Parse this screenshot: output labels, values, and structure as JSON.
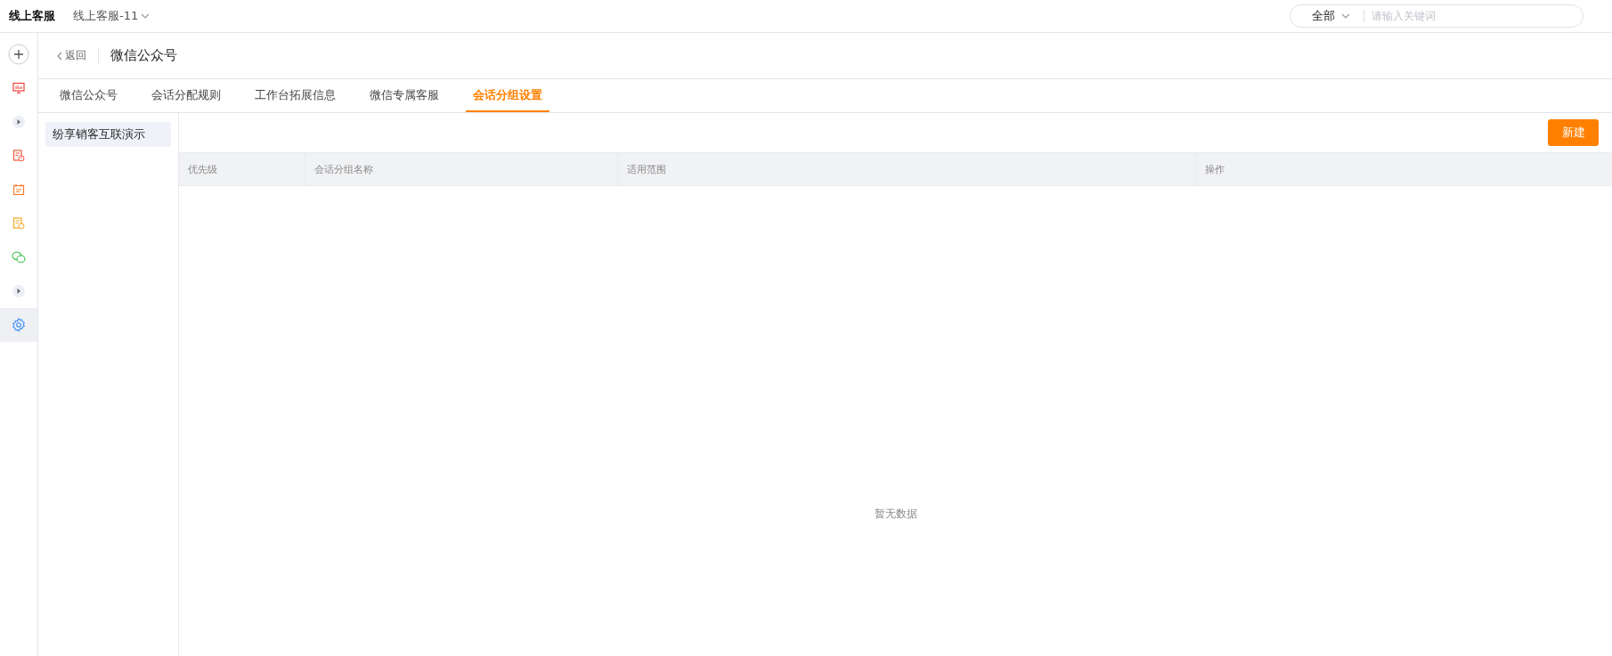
{
  "app": {
    "title": "线上客服",
    "workspace": "线上客服-11"
  },
  "search": {
    "scope": "全部",
    "placeholder": "请输入关键词"
  },
  "sidebar": {
    "items": [
      {
        "kind": "add",
        "selected": false
      },
      {
        "kind": "monitor",
        "selected": false
      },
      {
        "kind": "expand",
        "selected": false
      },
      {
        "kind": "document",
        "selected": false
      },
      {
        "kind": "calendar",
        "selected": false
      },
      {
        "kind": "report",
        "selected": false
      },
      {
        "kind": "chat",
        "selected": false
      },
      {
        "kind": "expand",
        "selected": false
      },
      {
        "kind": "settings",
        "selected": true
      }
    ]
  },
  "header": {
    "back": "返回",
    "title": "微信公众号"
  },
  "tabs": [
    {
      "label": "微信公众号",
      "selected": false
    },
    {
      "label": "会话分配规则",
      "selected": false
    },
    {
      "label": "工作台拓展信息",
      "selected": false
    },
    {
      "label": "微信专属客服",
      "selected": false
    },
    {
      "label": "会话分组设置",
      "selected": true
    }
  ],
  "groups": [
    {
      "label": "纷享销客互联演示",
      "selected": true
    }
  ],
  "toolbar": {
    "new_button": "新建"
  },
  "table": {
    "columns": [
      "优先级",
      "会话分组名称",
      "适用范围",
      "操作"
    ],
    "empty_text": "暂无数据"
  }
}
